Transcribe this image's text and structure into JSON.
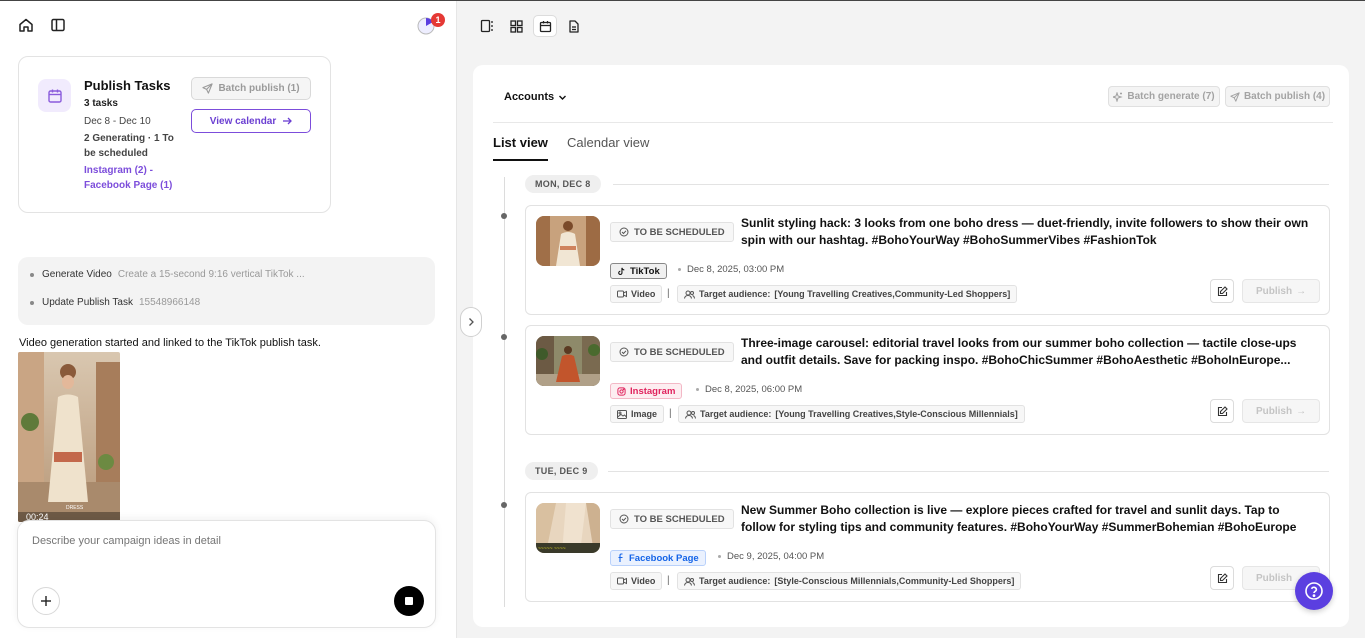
{
  "left_panel": {
    "notification_count": "1",
    "task_card": {
      "title": "Publish Tasks",
      "count": "3 tasks",
      "date_range": "Dec 8 - Dec 10",
      "status": "2 Generating · 1 To be scheduled",
      "platforms": "Instagram (2) - Facebook Page (1)",
      "batch_publish": "Batch publish (1)",
      "view_calendar": "View calendar"
    },
    "actions": [
      {
        "label": "Generate Video",
        "detail": "Create a 15-second 9:16 vertical TikTok ..."
      },
      {
        "label": "Update Publish Task",
        "detail": "15548966148"
      }
    ],
    "message": "Video generation started and linked to the TikTok publish task.",
    "video": {
      "duration": "00:24",
      "overlay_text": "DRESS"
    },
    "composer": {
      "placeholder": "Describe your campaign ideas in detail"
    }
  },
  "right_panel": {
    "accounts_label": "Accounts",
    "batch_generate": "Batch generate (7)",
    "batch_publish": "Batch publish (4)",
    "tabs": {
      "list": "List view",
      "calendar": "Calendar view"
    },
    "date_groups": [
      "MON, DEC 8",
      "TUE, DEC 9"
    ],
    "posts": [
      {
        "status": "TO BE SCHEDULED",
        "caption": "Sunlit styling hack: 3 looks from one boho dress — duet-friendly, invite followers to show their own spin with our hashtag. #BohoYourWay #BohoSummerVibes #FashionTok",
        "platform": "TikTok",
        "time": "Dec 8, 2025, 03:00 PM",
        "type": "Video",
        "audience_label": "Target audience:",
        "audience": "[Young Travelling Creatives,Community-Led Shoppers]",
        "publish": "Publish"
      },
      {
        "status": "TO BE SCHEDULED",
        "caption": "Three-image carousel: editorial travel looks from our summer boho collection — tactile close-ups and outfit details. Save for packing inspo. #BohoChicSummer #BohoAesthetic #BohoInEurope...",
        "platform": "Instagram",
        "time": "Dec 8, 2025, 06:00 PM",
        "type": "Image",
        "audience_label": "Target audience:",
        "audience": "[Young Travelling Creatives,Style-Conscious Millennials]",
        "publish": "Publish"
      },
      {
        "status": "TO BE SCHEDULED",
        "caption": "New Summer Boho collection is live — explore pieces crafted for travel and sunlit days. Tap to follow for styling tips and community features. #BohoYourWay #SummerBohemian #BohoEurope",
        "platform": "Facebook Page",
        "time": "Dec 9, 2025, 04:00 PM",
        "type": "Video",
        "audience_label": "Target audience:",
        "audience": "[Style-Conscious Millennials,Community-Led Shoppers]",
        "publish": "Publish"
      }
    ]
  },
  "colors": {
    "accent": "#7c4ddb",
    "help_button": "#5b3fe0",
    "instagram": "#e0245e",
    "facebook": "#1464e8"
  }
}
